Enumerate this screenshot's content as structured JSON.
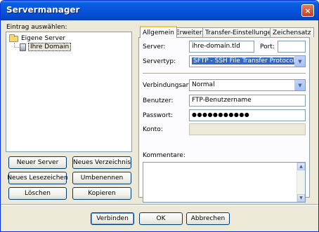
{
  "window": {
    "title": "Servermanager",
    "close_label": "×"
  },
  "left": {
    "label": "Eintrag auswählen:",
    "tree": {
      "root": "Eigene Server",
      "child": "Ihre Domain"
    },
    "buttons": {
      "new_server": "Neuer Server",
      "new_folder": "Neues Verzeichnis",
      "new_bookmark": "Neues Lesezeichen",
      "rename": "Umbenennen",
      "delete": "Löschen",
      "copy": "Kopieren"
    }
  },
  "tabs": [
    "Allgemein",
    "Erweitert",
    "Transfer-Einstellungen",
    "Zeichensatz"
  ],
  "general": {
    "server_label": "Server:",
    "server_value": "ihre-domain.tld",
    "port_label": "Port:",
    "port_value": "",
    "servertype_label": "Servertyp:",
    "servertype_value": "SFTP - SSH File Transfer Protocol",
    "logon_label": "Verbindungsart:",
    "logon_value": "Normal",
    "user_label": "Benutzer:",
    "user_value": "FTP-Benutzername",
    "password_label": "Passwort:",
    "password_value": "●●●●●●●●●●●",
    "account_label": "Konto:",
    "account_value": "",
    "comments_label": "Kommentare:"
  },
  "footer": {
    "connect": "Verbinden",
    "ok": "OK",
    "cancel": "Abbrechen"
  },
  "colors": {
    "titlebar": "#0654dc",
    "selection": "#316ac5",
    "active_tab": "#ffc83c"
  },
  "icons": [
    "folder-icon",
    "server-icon",
    "close-icon",
    "chevron-down-icon"
  ]
}
